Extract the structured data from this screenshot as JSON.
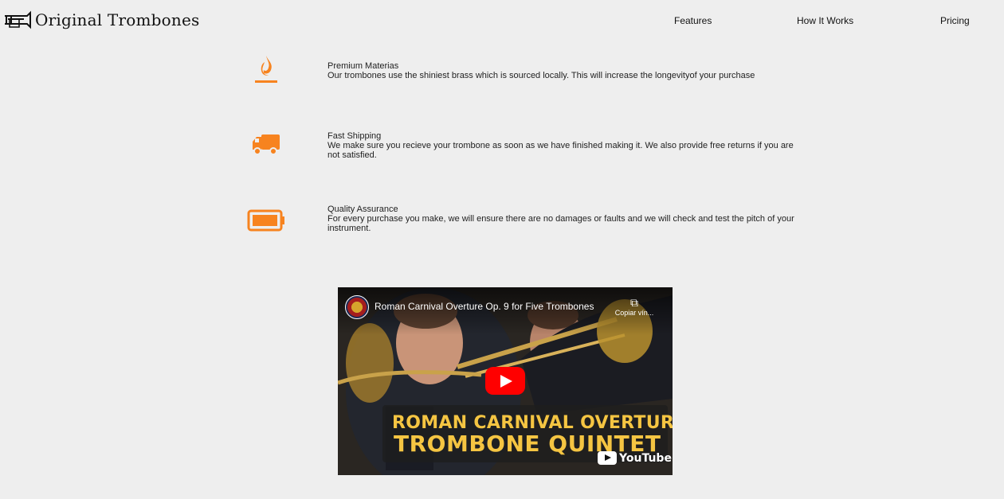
{
  "header": {
    "logo_text": "Original Trombones",
    "logo_icon": "trombone-icon",
    "nav": [
      {
        "label": "Features"
      },
      {
        "label": "How It Works"
      },
      {
        "label": "Pricing"
      }
    ]
  },
  "features": [
    {
      "icon": "fire-icon",
      "title": "Premium Materias",
      "description": "Our trombones use the shiniest brass which is sourced locally. This will increase the longevityof your purchase"
    },
    {
      "icon": "truck-icon",
      "title": "Fast Shipping",
      "description": "We make sure you recieve your trombone as soon as we have finished making it. We also provide free returns if you are not satisfied."
    },
    {
      "icon": "battery-full-icon",
      "title": "Quality Assurance",
      "description": "For every purchase you make, we will ensure there are no damages or faults and we will check and test the pitch of your instrument."
    }
  ],
  "video": {
    "title": "Roman Carnival Overture Op. 9 for Five Trombones",
    "copy_label": "Copiar vín...",
    "thumb_line1": "ROMAN CARNIVAL OVERTURE",
    "thumb_line2": "TROMBONE QUINTET",
    "watermark": "YouTube"
  },
  "colors": {
    "accent": "#f7831f",
    "background": "#eeeeee",
    "thumb_text": "#f5c542",
    "play_button": "#ff0000"
  }
}
